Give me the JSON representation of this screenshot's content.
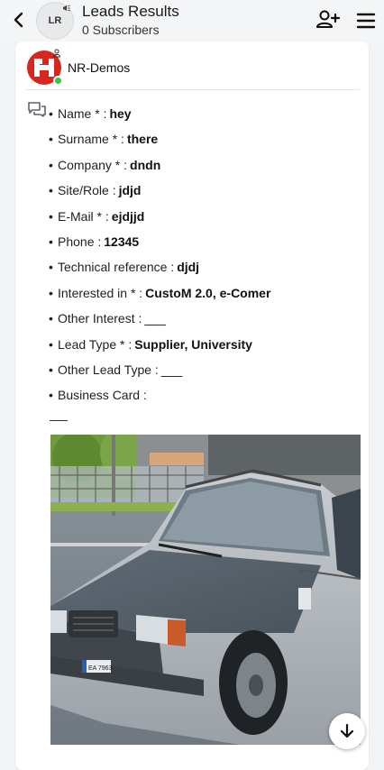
{
  "header": {
    "avatar_initials": "LR",
    "title": "Leads Results",
    "subtitle": "0 Subscribers"
  },
  "message": {
    "sender": "NR-Demos",
    "fields": [
      {
        "label": "Name * :",
        "value": "hey"
      },
      {
        "label": "Surname * :",
        "value": "there"
      },
      {
        "label": "Company * :",
        "value": "dndn"
      },
      {
        "label": "Site/Role :",
        "value": "jdjd"
      },
      {
        "label": "E-Mail * :",
        "value": "ejdjjd"
      },
      {
        "label": "Phone :",
        "value": "12345"
      },
      {
        "label": "Technical reference :",
        "value": "djdj"
      },
      {
        "label": "Interested in * :",
        "value": "CustoM 2.0, e-Comer"
      },
      {
        "label": "Other Interest :",
        "value": "___"
      },
      {
        "label": "Lead Type * :",
        "value": "Supplier, University"
      },
      {
        "label": "Other Lead Type :",
        "value": "___"
      },
      {
        "label": "Business Card :",
        "value": ""
      }
    ],
    "photo": {
      "subject": "car-photo",
      "plate_text": "EA 7963"
    }
  },
  "colors": {
    "header_bg": "#f4f5f6",
    "page_bg": "#f1f3f4",
    "card_bg": "#ffffff",
    "online": "#2ecc40",
    "brand_red": "#d7261e"
  },
  "icons": {
    "back": "chevron-left-icon",
    "add_user": "add-user-icon",
    "menu": "hamburger-menu-icon",
    "chat": "chat-bubbles-icon",
    "scroll_down": "arrow-down-icon"
  }
}
